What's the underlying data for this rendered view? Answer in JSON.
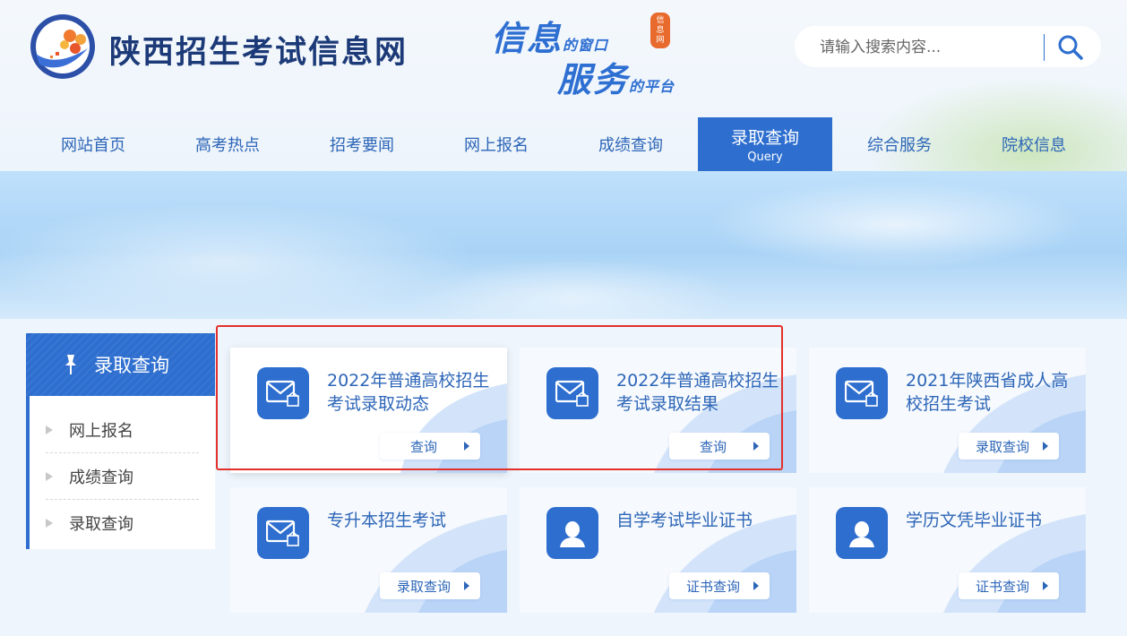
{
  "header": {
    "site_title": "陕西招生考试信息网",
    "slogan": {
      "line1_big": "信息",
      "line1_small": "的窗口",
      "seal_text": [
        "信",
        "息",
        "网"
      ],
      "line2_big": "服务",
      "line2_small": "的平台"
    },
    "search": {
      "placeholder": "请输入搜索内容..."
    }
  },
  "nav": {
    "items": [
      {
        "label": "网站首页"
      },
      {
        "label": "高考热点"
      },
      {
        "label": "招考要闻"
      },
      {
        "label": "网上报名"
      },
      {
        "label": "成绩查询"
      },
      {
        "label": "录取查询",
        "sub": "Query",
        "active": true
      },
      {
        "label": "综合服务"
      },
      {
        "label": "院校信息"
      }
    ]
  },
  "sidebar": {
    "title": "录取查询",
    "items": [
      {
        "label": "网上报名"
      },
      {
        "label": "成绩查询"
      },
      {
        "label": "录取查询"
      }
    ]
  },
  "cards": [
    {
      "title": "2022年普通高校招生考试录取动态",
      "button": "查询",
      "icon": "envelope-icon"
    },
    {
      "title": "2022年普通高校招生考试录取结果",
      "button": "查询",
      "icon": "envelope-icon"
    },
    {
      "title": "2021年陕西省成人高校招生考试",
      "button": "录取查询",
      "icon": "envelope-icon"
    },
    {
      "title": "专升本招生考试",
      "button": "录取查询",
      "icon": "envelope-icon"
    },
    {
      "title": "自学考试毕业证书",
      "button": "证书查询",
      "icon": "person-icon"
    },
    {
      "title": "学历文凭毕业证书",
      "button": "证书查询",
      "icon": "person-icon"
    }
  ],
  "colors": {
    "primary": "#2d6ecf",
    "nav_text": "#2d66b8",
    "title": "#1c3a78",
    "highlight": "#e3302a"
  }
}
